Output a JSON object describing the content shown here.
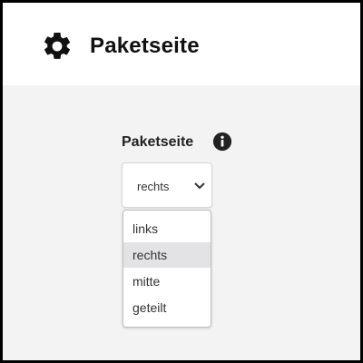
{
  "header": {
    "title": "Paketseite",
    "icon": "gear-icon"
  },
  "field": {
    "label": "Paketseite",
    "info_icon": "info-icon",
    "selected": "rechts",
    "options": [
      "links",
      "rechts",
      "mitte",
      "geteilt"
    ],
    "highlighted_index": 1
  },
  "colors": {
    "header_bg": "#ffffff",
    "page_bg": "#f3f3f3",
    "highlight": "#e3e3e6"
  }
}
